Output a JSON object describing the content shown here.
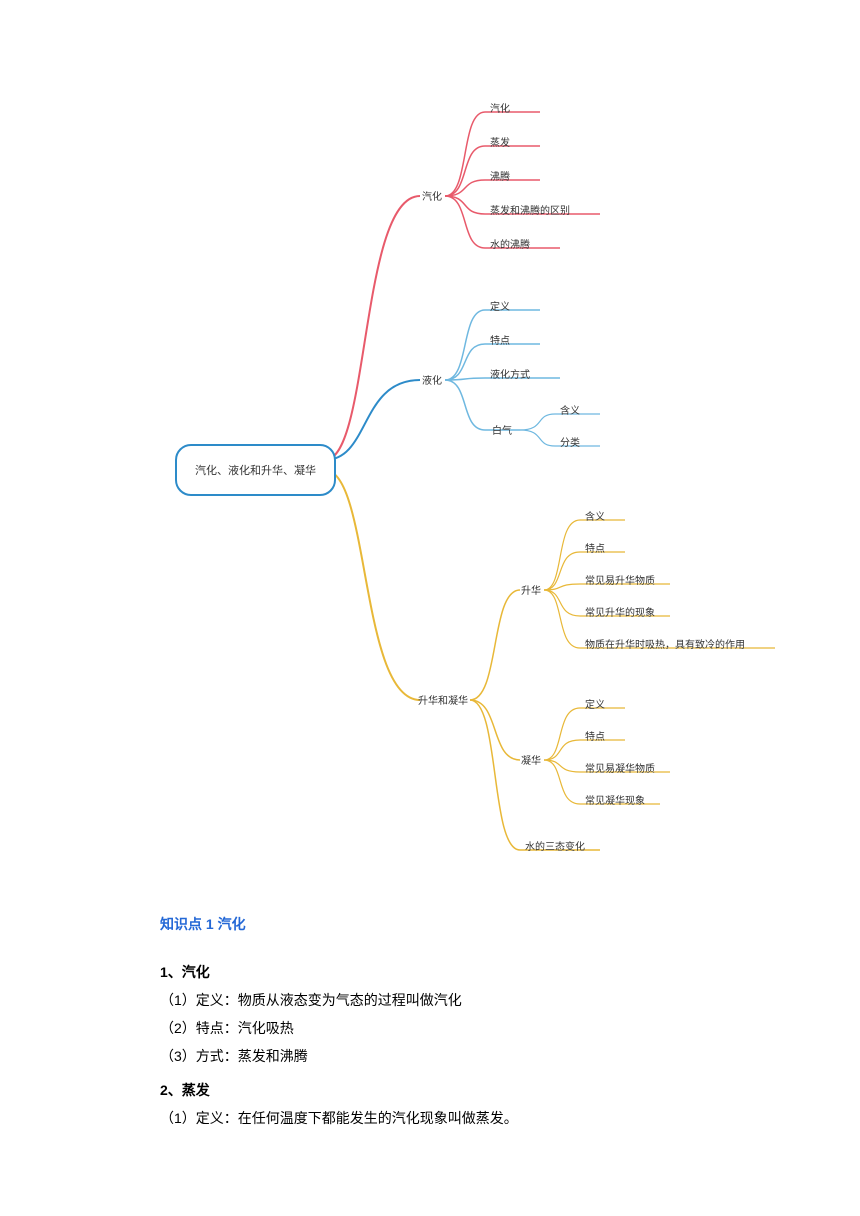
{
  "mindmap": {
    "root": "汽化、液化和升华、凝华",
    "branch1": {
      "label": "汽化",
      "children": [
        "汽化",
        "蒸发",
        "沸腾",
        "蒸发和沸腾的区别",
        "水的沸腾"
      ]
    },
    "branch2": {
      "label": "液化",
      "children": [
        "定义",
        "特点",
        "液化方式"
      ],
      "sub": {
        "label": "白气",
        "children": [
          "含义",
          "分类"
        ]
      }
    },
    "branch3": {
      "label": "升华和凝华",
      "sub1": {
        "label": "升华",
        "children": [
          "含义",
          "特点",
          "常见易升华物质",
          "常见升华的现象",
          "物质在升华时吸热，具有致冷的作用"
        ]
      },
      "sub2": {
        "label": "凝华",
        "children": [
          "定义",
          "特点",
          "常见易凝华物质",
          "常见凝华现象"
        ]
      },
      "sub3": "水的三态变化"
    }
  },
  "text": {
    "sectionTitle": "知识点 1 汽化",
    "h1": "1、汽化",
    "p1": "（1）定义：物质从液态变为气态的过程叫做汽化",
    "p2": "（2）特点：汽化吸热",
    "p3": "（3）方式：蒸发和沸腾",
    "h2": "2、蒸发",
    "p4": "（1）定义：在任何温度下都能发生的汽化现象叫做蒸发。"
  },
  "colors": {
    "red": "#e85a6b",
    "blue": "#2d8bc9",
    "yellow": "#e8b838",
    "lightblue": "#6fb8e0"
  }
}
